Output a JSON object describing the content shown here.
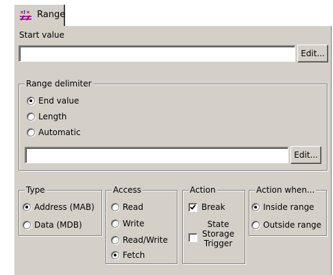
{
  "tab": {
    "label": "Range",
    "icon": "range-icon"
  },
  "start_value": {
    "label": "Start value",
    "value": "",
    "edit_label": "Edit..."
  },
  "range_delimiter": {
    "title": "Range delimiter",
    "options": [
      "End value",
      "Length",
      "Automatic"
    ],
    "selected": "End value",
    "value": "",
    "edit_label": "Edit..."
  },
  "type": {
    "title": "Type",
    "options": [
      "Address (MAB)",
      "Data (MDB)"
    ],
    "selected": "Address (MAB)"
  },
  "access": {
    "title": "Access",
    "options": [
      "Read",
      "Write",
      "Read/Write",
      "Fetch"
    ],
    "selected": "Fetch"
  },
  "action": {
    "title": "Action",
    "break_label": "Break",
    "break_checked": true,
    "state_storage_label_1": "State",
    "state_storage_label_2": "Storage",
    "state_storage_label_3": "Trigger",
    "state_storage_checked": false
  },
  "action_when": {
    "title": "Action when...",
    "options": [
      "Inside range",
      "Outside range"
    ],
    "selected": "Inside range"
  }
}
